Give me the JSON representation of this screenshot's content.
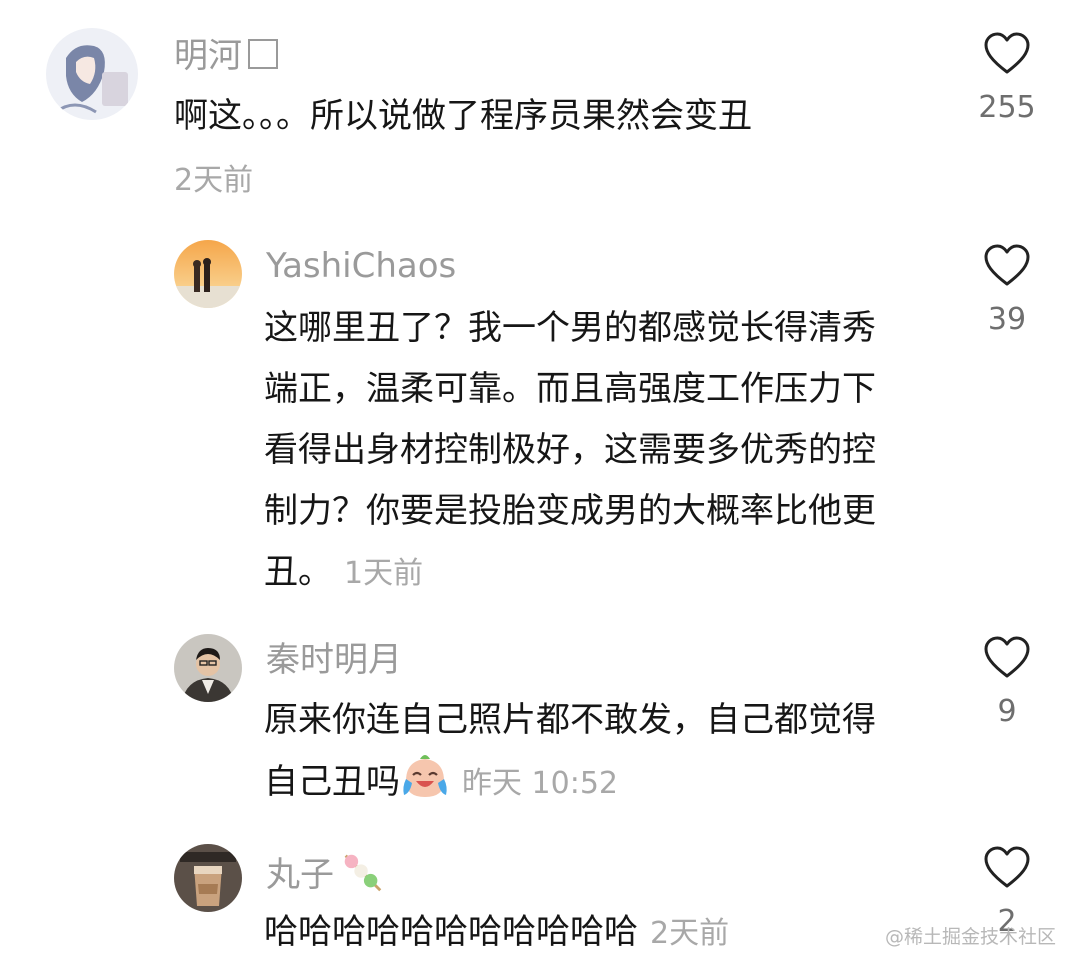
{
  "comments": [
    {
      "username": "明河",
      "text": "啊这。。。所以说做了程序员果然会变丑",
      "time": "2天前",
      "likes": "255",
      "avatar_icon": "anime-girl-avatar"
    },
    {
      "username": "YashiChaos",
      "text": "这哪里丑了？我一个男的都感觉长得清秀端正，温柔可靠。而且高强度工作压力下看得出身材控制极好，这需要多优秀的控制力？你要是投胎变成男的大概率比他更丑。",
      "time": "1天前",
      "likes": "39",
      "avatar_icon": "sunset-couple-avatar"
    },
    {
      "username": "秦时明月",
      "text": "原来你连自己照片都不敢发，自己都觉得自己丑吗",
      "emoji": "crying-laughing-emoji",
      "time": "昨天 10:52",
      "likes": "9",
      "avatar_icon": "man-in-suit-avatar"
    },
    {
      "username": "丸子",
      "username_emoji": "dango-emoji",
      "text": "哈哈哈哈哈哈哈哈哈哈哈",
      "time": "2天前",
      "likes": "2",
      "avatar_icon": "coffee-cup-avatar"
    }
  ],
  "watermark": "@稀土掘金技术社区"
}
